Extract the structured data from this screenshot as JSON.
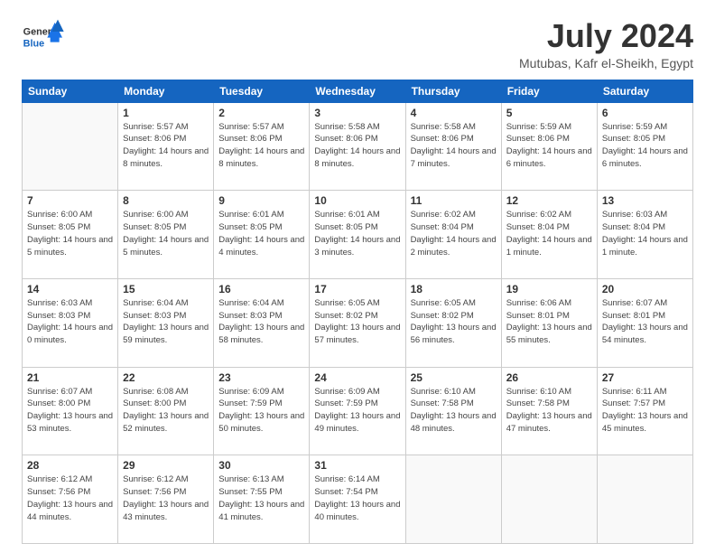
{
  "header": {
    "logo_general": "General",
    "logo_blue": "Blue",
    "month_title": "July 2024",
    "location": "Mutubas, Kafr el-Sheikh, Egypt"
  },
  "days_of_week": [
    "Sunday",
    "Monday",
    "Tuesday",
    "Wednesday",
    "Thursday",
    "Friday",
    "Saturday"
  ],
  "weeks": [
    [
      {
        "day": null
      },
      {
        "day": 1,
        "sunrise": "5:57 AM",
        "sunset": "8:06 PM",
        "daylight": "14 hours and 8 minutes."
      },
      {
        "day": 2,
        "sunrise": "5:57 AM",
        "sunset": "8:06 PM",
        "daylight": "14 hours and 8 minutes."
      },
      {
        "day": 3,
        "sunrise": "5:58 AM",
        "sunset": "8:06 PM",
        "daylight": "14 hours and 8 minutes."
      },
      {
        "day": 4,
        "sunrise": "5:58 AM",
        "sunset": "8:06 PM",
        "daylight": "14 hours and 7 minutes."
      },
      {
        "day": 5,
        "sunrise": "5:59 AM",
        "sunset": "8:06 PM",
        "daylight": "14 hours and 6 minutes."
      },
      {
        "day": 6,
        "sunrise": "5:59 AM",
        "sunset": "8:05 PM",
        "daylight": "14 hours and 6 minutes."
      }
    ],
    [
      {
        "day": 7,
        "sunrise": "6:00 AM",
        "sunset": "8:05 PM",
        "daylight": "14 hours and 5 minutes."
      },
      {
        "day": 8,
        "sunrise": "6:00 AM",
        "sunset": "8:05 PM",
        "daylight": "14 hours and 5 minutes."
      },
      {
        "day": 9,
        "sunrise": "6:01 AM",
        "sunset": "8:05 PM",
        "daylight": "14 hours and 4 minutes."
      },
      {
        "day": 10,
        "sunrise": "6:01 AM",
        "sunset": "8:05 PM",
        "daylight": "14 hours and 3 minutes."
      },
      {
        "day": 11,
        "sunrise": "6:02 AM",
        "sunset": "8:04 PM",
        "daylight": "14 hours and 2 minutes."
      },
      {
        "day": 12,
        "sunrise": "6:02 AM",
        "sunset": "8:04 PM",
        "daylight": "14 hours and 1 minute."
      },
      {
        "day": 13,
        "sunrise": "6:03 AM",
        "sunset": "8:04 PM",
        "daylight": "14 hours and 1 minute."
      }
    ],
    [
      {
        "day": 14,
        "sunrise": "6:03 AM",
        "sunset": "8:03 PM",
        "daylight": "14 hours and 0 minutes."
      },
      {
        "day": 15,
        "sunrise": "6:04 AM",
        "sunset": "8:03 PM",
        "daylight": "13 hours and 59 minutes."
      },
      {
        "day": 16,
        "sunrise": "6:04 AM",
        "sunset": "8:03 PM",
        "daylight": "13 hours and 58 minutes."
      },
      {
        "day": 17,
        "sunrise": "6:05 AM",
        "sunset": "8:02 PM",
        "daylight": "13 hours and 57 minutes."
      },
      {
        "day": 18,
        "sunrise": "6:05 AM",
        "sunset": "8:02 PM",
        "daylight": "13 hours and 56 minutes."
      },
      {
        "day": 19,
        "sunrise": "6:06 AM",
        "sunset": "8:01 PM",
        "daylight": "13 hours and 55 minutes."
      },
      {
        "day": 20,
        "sunrise": "6:07 AM",
        "sunset": "8:01 PM",
        "daylight": "13 hours and 54 minutes."
      }
    ],
    [
      {
        "day": 21,
        "sunrise": "6:07 AM",
        "sunset": "8:00 PM",
        "daylight": "13 hours and 53 minutes."
      },
      {
        "day": 22,
        "sunrise": "6:08 AM",
        "sunset": "8:00 PM",
        "daylight": "13 hours and 52 minutes."
      },
      {
        "day": 23,
        "sunrise": "6:09 AM",
        "sunset": "7:59 PM",
        "daylight": "13 hours and 50 minutes."
      },
      {
        "day": 24,
        "sunrise": "6:09 AM",
        "sunset": "7:59 PM",
        "daylight": "13 hours and 49 minutes."
      },
      {
        "day": 25,
        "sunrise": "6:10 AM",
        "sunset": "7:58 PM",
        "daylight": "13 hours and 48 minutes."
      },
      {
        "day": 26,
        "sunrise": "6:10 AM",
        "sunset": "7:58 PM",
        "daylight": "13 hours and 47 minutes."
      },
      {
        "day": 27,
        "sunrise": "6:11 AM",
        "sunset": "7:57 PM",
        "daylight": "13 hours and 45 minutes."
      }
    ],
    [
      {
        "day": 28,
        "sunrise": "6:12 AM",
        "sunset": "7:56 PM",
        "daylight": "13 hours and 44 minutes."
      },
      {
        "day": 29,
        "sunrise": "6:12 AM",
        "sunset": "7:56 PM",
        "daylight": "13 hours and 43 minutes."
      },
      {
        "day": 30,
        "sunrise": "6:13 AM",
        "sunset": "7:55 PM",
        "daylight": "13 hours and 41 minutes."
      },
      {
        "day": 31,
        "sunrise": "6:14 AM",
        "sunset": "7:54 PM",
        "daylight": "13 hours and 40 minutes."
      },
      {
        "day": null
      },
      {
        "day": null
      },
      {
        "day": null
      }
    ]
  ]
}
